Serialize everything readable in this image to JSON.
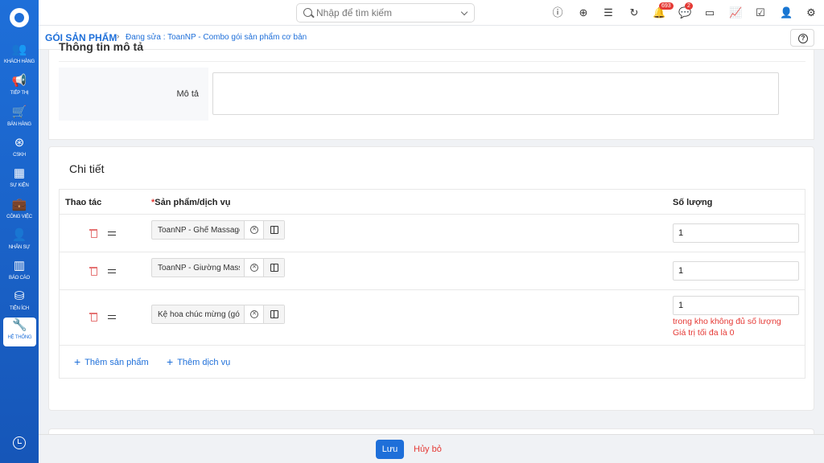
{
  "sidebar": {
    "items": [
      {
        "label": "KHÁCH HÀNG",
        "icon": "users-icon",
        "glyph": "👥"
      },
      {
        "label": "TIẾP THỊ",
        "icon": "megaphone-icon",
        "glyph": "📢"
      },
      {
        "label": "BÁN HÀNG",
        "icon": "cart-icon",
        "glyph": "🛒"
      },
      {
        "label": "CSKH",
        "icon": "support-icon",
        "glyph": "⊛"
      },
      {
        "label": "SỰ KIỆN",
        "icon": "calendar-icon",
        "glyph": "▦"
      },
      {
        "label": "CÔNG VIỆC",
        "icon": "briefcase-icon",
        "glyph": "💼"
      },
      {
        "label": "NHÂN SỰ",
        "icon": "person-icon",
        "glyph": "👤"
      },
      {
        "label": "BÁO CÁO",
        "icon": "report-icon",
        "glyph": "▥"
      },
      {
        "label": "TIỆN ÍCH",
        "icon": "box-icon",
        "glyph": "⛁"
      },
      {
        "label": "HỆ THỐNG",
        "icon": "wrench-icon",
        "glyph": "🔧",
        "active": true
      }
    ]
  },
  "topbar": {
    "search_placeholder": "Nhập để tìm kiếm",
    "icons": [
      {
        "name": "alert-icon",
        "glyph": "ⓘ"
      },
      {
        "name": "add-circle-icon",
        "glyph": "⊕"
      },
      {
        "name": "list-icon",
        "glyph": "☰"
      },
      {
        "name": "refresh-icon",
        "glyph": "↻"
      },
      {
        "name": "bell-icon",
        "glyph": "🔔",
        "badge": "693"
      },
      {
        "name": "chat-icon",
        "glyph": "💬",
        "badge": "2"
      },
      {
        "name": "calendar-icon",
        "glyph": "▭"
      },
      {
        "name": "chart-icon",
        "glyph": "📈"
      },
      {
        "name": "checkbox-icon",
        "glyph": "☑"
      },
      {
        "name": "user-icon",
        "glyph": "👤"
      },
      {
        "name": "settings-icon",
        "glyph": "⚙"
      }
    ]
  },
  "breadcrumb": {
    "main": "GÓI SẢN PHẨM",
    "separator": "›",
    "sub": "Đang sửa : ToanNP - Combo gói sản phẩm cơ bản"
  },
  "description_section": {
    "title": "Thông tin mô tả",
    "label": "Mô tả",
    "value": ""
  },
  "detail_section": {
    "title": "Chi tiết",
    "columns": {
      "action": "Thao tác",
      "required_mark": "*",
      "product": "Sản phẩm/dịch vụ",
      "quantity": "Số lượng"
    },
    "rows": [
      {
        "product": "ToanNP - Ghế Massage",
        "quantity": "1",
        "errors": []
      },
      {
        "product": "ToanNP - Giường Massage",
        "quantity": "1",
        "errors": []
      },
      {
        "product": "Kệ hoa chúc mừng (gói)",
        "quantity": "1",
        "errors": [
          "trong kho không đủ số lượng",
          "Giá trị tối đa là 0"
        ]
      }
    ],
    "add_product": "Thêm sản phẩm",
    "add_service": "Thêm dịch vụ",
    "plus": "+"
  },
  "footer": {
    "save": "Lưu",
    "cancel": "Hủy bỏ"
  },
  "colors": {
    "primary": "#1e6fd9",
    "danger": "#e53935"
  }
}
